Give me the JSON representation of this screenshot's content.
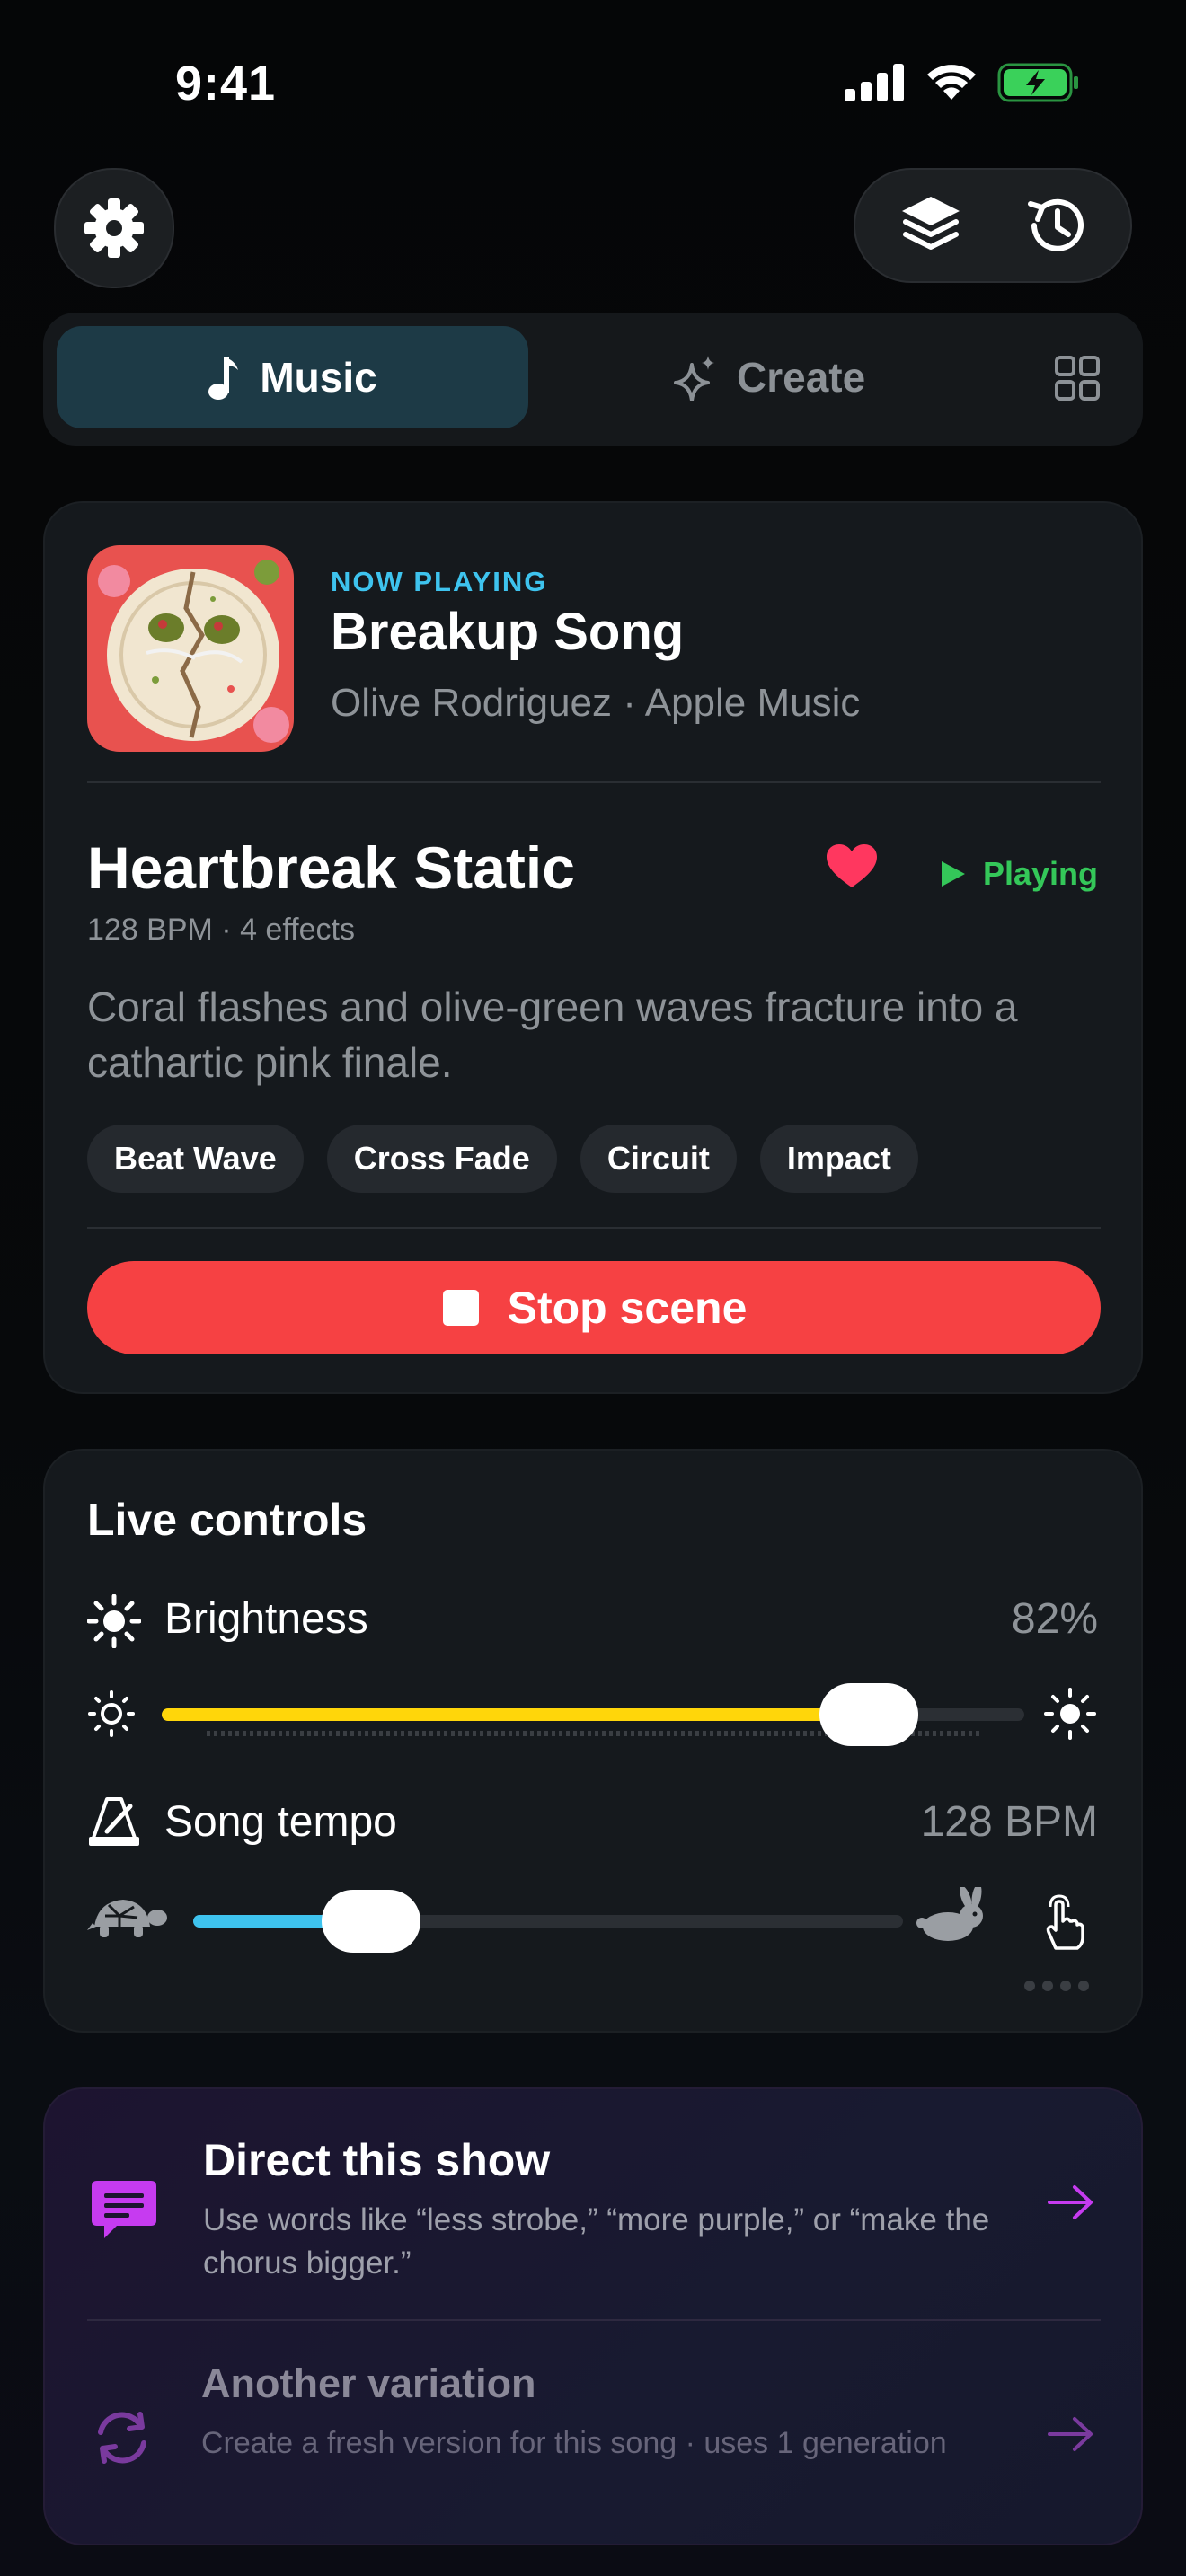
{
  "status_bar": {
    "time": "9:41"
  },
  "tabs": {
    "music": "Music",
    "create": "Create"
  },
  "now_playing": {
    "eyebrow": "NOW PLAYING",
    "title": "Breakup Song",
    "artist_line": "Olive Rodriguez · Apple Music"
  },
  "scene": {
    "title": "Heartbreak Static",
    "meta": "128 BPM · 4 effects",
    "status": "Playing",
    "favorited": true,
    "description": "Coral flashes and olive-green waves fracture into a cathartic pink finale.",
    "tags": [
      "Beat Wave",
      "Cross Fade",
      "Circuit",
      "Impact"
    ],
    "stop_label": "Stop scene"
  },
  "live_controls": {
    "title": "Live controls",
    "brightness": {
      "label": "Brightness",
      "value_text": "82%",
      "level": 0.82
    },
    "tempo": {
      "label": "Song tempo",
      "value_text": "128 BPM",
      "level": 0.25
    }
  },
  "direct": {
    "title": "Direct this show",
    "subtitle": "Use words like “less strobe,” “more purple,” or “make the chorus bigger.”"
  },
  "variation": {
    "title": "Another variation",
    "subtitle": "Create a fresh version for this song · uses 1 generation"
  },
  "colors": {
    "accent_teal": "#3ec3ee",
    "stop_red": "#f64143",
    "playing_green": "#34c759",
    "brightness_yellow": "#ffd60a",
    "tempo_blue": "#3ec3ee",
    "heart_pink": "#ff375f",
    "direct_purple": "#c63bf0"
  }
}
